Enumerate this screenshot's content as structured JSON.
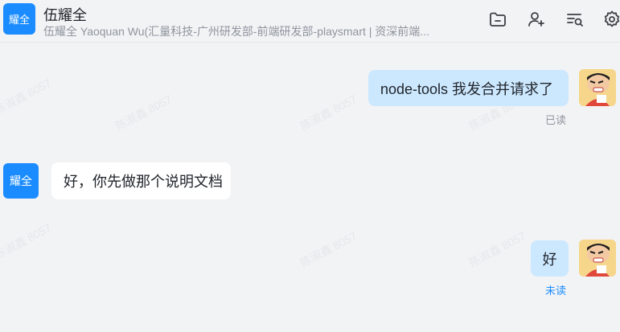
{
  "header": {
    "avatar_text": "耀全",
    "name": "伍耀全",
    "subtitle": "伍耀全 Yaoquan Wu(汇量科技-广州研发部-前端研发部-playsmart | 资深前端..."
  },
  "toolbar_icons": [
    "folder-icon",
    "add-user-icon",
    "search-list-icon",
    "gear-icon"
  ],
  "watermark": "陈淑鑫 8057",
  "messages": [
    {
      "side": "mine",
      "text": "node-tools 我发合并请求了",
      "status": "已读"
    },
    {
      "side": "theirs",
      "avatar_text": "耀全",
      "text": "好，你先做那个说明文档"
    },
    {
      "side": "mine",
      "text": "好",
      "status": "未读"
    }
  ],
  "colors": {
    "accent": "#1a8cff",
    "mine_bubble": "#cce8ff",
    "theirs_bubble": "#ffffff",
    "read": "#8f959e",
    "unread": "#1a8cff"
  }
}
